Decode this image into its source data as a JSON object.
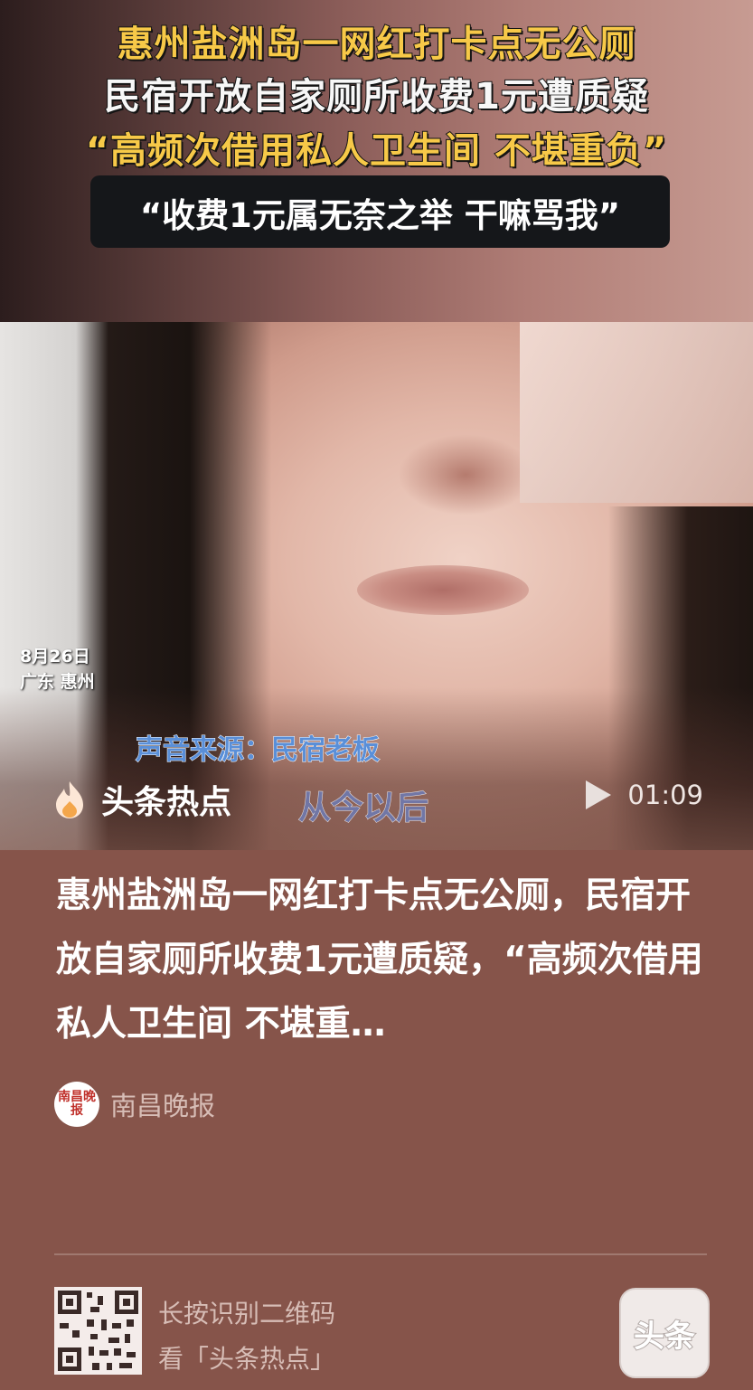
{
  "video": {
    "headline": {
      "line1": "惠州盐洲岛一网红打卡点无公厕",
      "line2": "民宿开放自家厕所收费1元遭质疑",
      "line3": "“高频次借用私人卫生间 不堪重负”",
      "quote": "“收费1元属无奈之举 干嘛骂我”"
    },
    "date": "8月26日",
    "location": "广东 惠州",
    "source": "声音来源：民宿老板",
    "subtitle": "从今以后",
    "brand": "头条热点",
    "brand_icon": "flame-icon",
    "duration": "01:09"
  },
  "article": {
    "title": "惠州盐洲岛一网红打卡点无公厕，民宿开放自家厕所收费1元遭质疑，“高频次借用私人卫生间 不堪重…",
    "publisher": "南昌晚报",
    "publisher_logo_text": "南昌晚报"
  },
  "footer": {
    "qr_line1": "长按识别二维码",
    "qr_line2": "看「头条热点」",
    "app_badge": "头条"
  },
  "colors": {
    "background": "#86544a",
    "headline_yellow": "#f7c948",
    "source_blue": "#5a8fd8"
  }
}
